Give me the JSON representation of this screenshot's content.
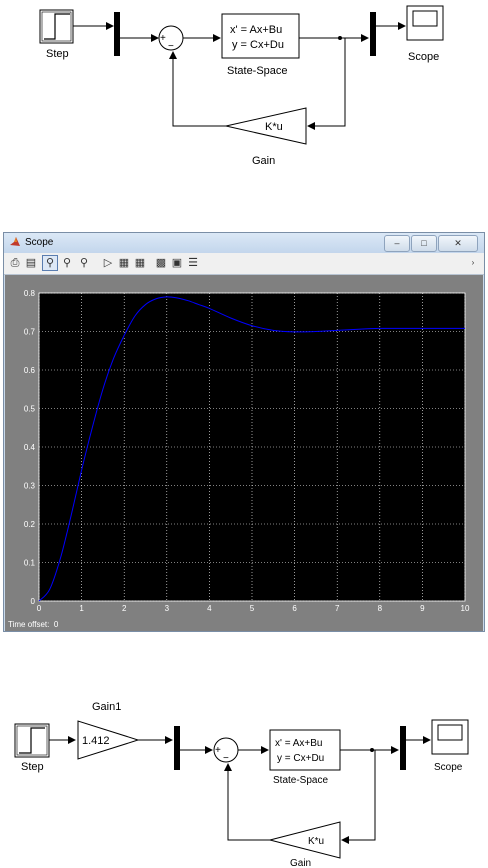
{
  "diagram_top": {
    "blocks": {
      "step_label": "Step",
      "mux_label": "",
      "sum_plus": "+",
      "sum_minus": "−",
      "ss_line1": "x' = Ax+Bu",
      "ss_line2": "y = Cx+Du",
      "ss_label": "State-Space",
      "scope_label": "Scope",
      "gain_text": "K*u",
      "gain_label": "Gain"
    }
  },
  "scope_window": {
    "title": "Scope",
    "buttons": {
      "minimize": "–",
      "maximize": "□",
      "close": "✕"
    },
    "toolbar_icons": [
      "print-icon",
      "params-icon",
      "zoom-icon",
      "zoom-x-icon",
      "zoom-y-icon",
      "autoscale-icon",
      "save-axes-icon",
      "restore-axes-icon",
      "floating-scope-icon",
      "lock-icon",
      "signal-select-icon"
    ],
    "time_offset_label": "Time offset:",
    "time_offset_value": "0"
  },
  "chart_data": {
    "type": "line",
    "title": "",
    "xlabel": "",
    "ylabel": "",
    "xlim": [
      0,
      10
    ],
    "ylim": [
      0,
      0.8
    ],
    "xticks": [
      "0",
      "1",
      "2",
      "3",
      "4",
      "5",
      "6",
      "7",
      "8",
      "9",
      "10"
    ],
    "yticks": [
      "0",
      "0.1",
      "0.2",
      "0.3",
      "0.4",
      "0.5",
      "0.6",
      "0.7",
      "0.8"
    ],
    "grid": true,
    "background": "#000000",
    "line_color": "#0000ff",
    "series": [
      {
        "x": [
          0,
          0.25,
          0.5,
          0.75,
          1,
          1.25,
          1.5,
          1.75,
          2,
          2.25,
          2.5,
          2.75,
          3,
          3.25,
          3.5,
          3.75,
          4,
          4.5,
          5,
          5.5,
          6,
          6.5,
          7,
          7.5,
          8,
          8.5,
          9,
          9.5,
          10
        ],
        "values": [
          0,
          0.03,
          0.11,
          0.22,
          0.34,
          0.45,
          0.55,
          0.63,
          0.69,
          0.74,
          0.77,
          0.785,
          0.79,
          0.787,
          0.78,
          0.77,
          0.76,
          0.735,
          0.715,
          0.703,
          0.699,
          0.7,
          0.703,
          0.706,
          0.708,
          0.708,
          0.708,
          0.708,
          0.708
        ]
      }
    ]
  },
  "diagram_bottom": {
    "blocks": {
      "step_label": "Step",
      "gain1_title": "Gain1",
      "gain1_value": "1.412",
      "sum_plus": "+",
      "sum_minus": "−",
      "ss_line1": "x' = Ax+Bu",
      "ss_line2": "y = Cx+Du",
      "ss_label": "State-Space",
      "scope_label": "Scope",
      "gain_text": "K*u",
      "gain_label": "Gain"
    }
  }
}
